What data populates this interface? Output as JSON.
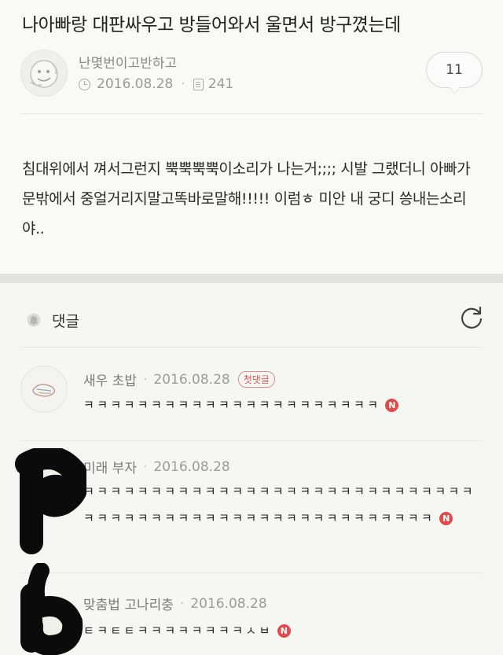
{
  "post": {
    "title": "나아빠랑 대판싸우고 방들어와서 울면서 방구꼈는데",
    "author": "난몇번이고반하고",
    "date": "2016.08.28",
    "views": "241",
    "comment_count": "11",
    "body": "침대위에서 껴서그런지 뿍뿍뿍뿍이소리가 나는거;;;; 시발 그랬더니 아빠가 문밖에서 중얼거리지말고똑바로말해!!!!! 이럼ㅎ 미안 내 궁디 씅내는소리야.."
  },
  "comments_section": {
    "title": "댓글"
  },
  "comments": [
    {
      "author": "새우 초밥",
      "date": "2016.08.28",
      "badge": "첫댓글",
      "text": "ㅋㅋㅋㅋㅋㅋㅋㅋㅋㅋㅋㅋㅋㅋㅋㅋㅋㅋㅋㅋㅋㅋ",
      "new_mark": "N"
    },
    {
      "author": "미래 부자",
      "date": "2016.08.28",
      "text": "ㅋㅋㅋㅋㅋㅋㅋㅋㅋㅋㅋㅋㅋㅋㅋㅋㅋㅋㅋㅋㅋㅋㅋㅋㅋㅋㅋㅋㅋㅋㅋㅋㅋㅋㅋㅋㅋㅋㅋㅋㅋㅋㅋㅋㅋㅋㅋㅋㅋㅋㅋㅋㅋㅋㅋ",
      "new_mark": "N"
    },
    {
      "author": "맞춤법 고나리충",
      "date": "2016.08.28",
      "text": "ㅌㅋㅌㅌㅋㅋㅋㅋㅋㅋㅋㅋㅅㅂ",
      "new_mark": "N"
    }
  ],
  "colors": {
    "background": "#f5f8f2",
    "badge_red": "#e25252",
    "new_red": "#e04a4a"
  }
}
